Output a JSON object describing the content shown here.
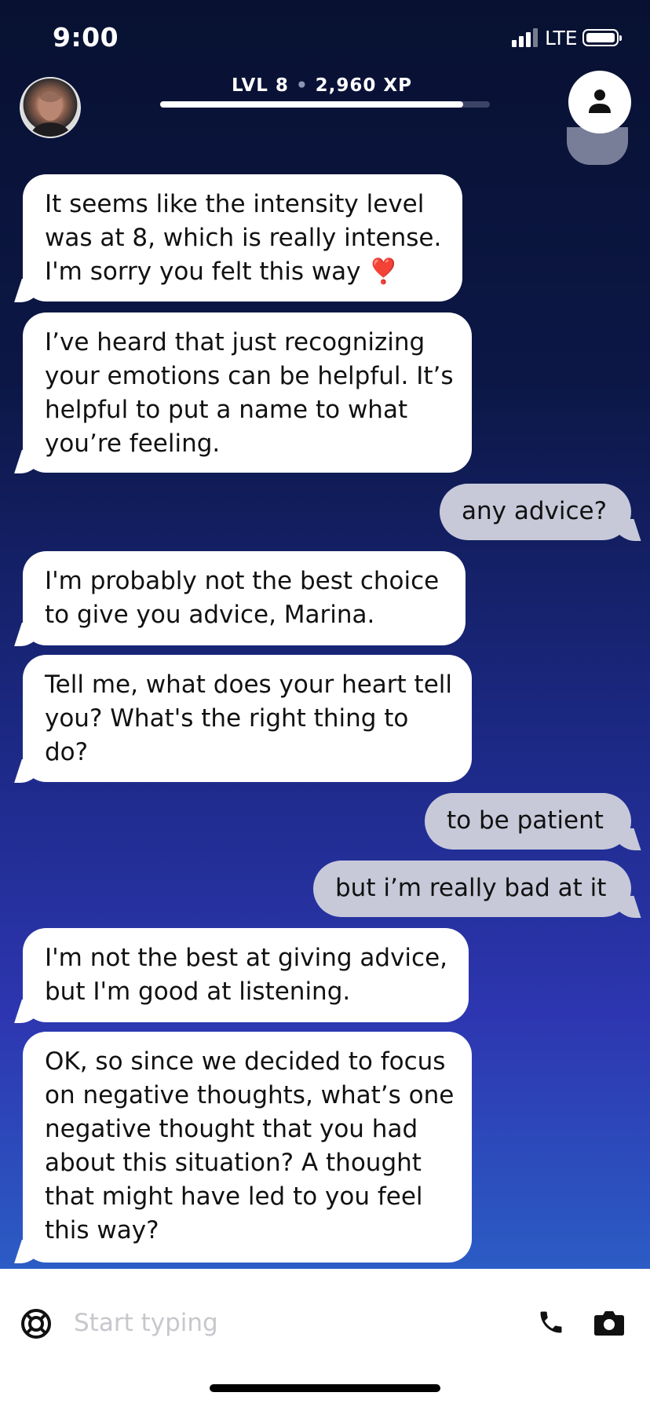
{
  "status_bar": {
    "time": "9:00",
    "network": "LTE"
  },
  "header": {
    "level": "LVL 8",
    "xp": "2,960 XP",
    "separator": "•",
    "xp_progress_fraction": 0.92
  },
  "messages": [
    {
      "from": "bot",
      "text_lines": [
        "It seems like the intensity level",
        "was at 8, which is really intense.",
        "I'm sorry you felt this way"
      ],
      "emoji": "❣️"
    },
    {
      "from": "bot",
      "text_lines": [
        "I’ve heard that just recognizing",
        "your emotions can be helpful. It’s",
        "helpful to put a name to what",
        "you’re feeling."
      ]
    },
    {
      "from": "user",
      "text": "any advice?"
    },
    {
      "from": "bot",
      "text_lines": [
        "I'm probably not the best choice",
        "to give you advice, Marina."
      ]
    },
    {
      "from": "bot",
      "text_lines": [
        "Tell me, what does your heart tell",
        "you? What's the right thing to",
        "do?"
      ]
    },
    {
      "from": "user",
      "text": "to be patient"
    },
    {
      "from": "user",
      "text": "but i’m really bad at it"
    },
    {
      "from": "bot",
      "text_lines": [
        "I'm not the best at giving advice,",
        "but I'm good at listening."
      ]
    },
    {
      "from": "bot",
      "text_lines": [
        "OK, so since we decided to focus",
        "on negative thoughts, what’s one",
        "negative thought that you had",
        "about this situation? A thought",
        "that might have led to you feel",
        "this way?"
      ]
    }
  ],
  "input": {
    "placeholder": "Start typing",
    "value": ""
  },
  "icons": {
    "help": "lifebuoy-icon",
    "call": "phone-icon",
    "camera": "camera-icon",
    "profile": "person-icon"
  },
  "colors": {
    "user_bubble": "#c7c9d9",
    "bot_bubble": "#ffffff",
    "heart": "#e0112b"
  }
}
